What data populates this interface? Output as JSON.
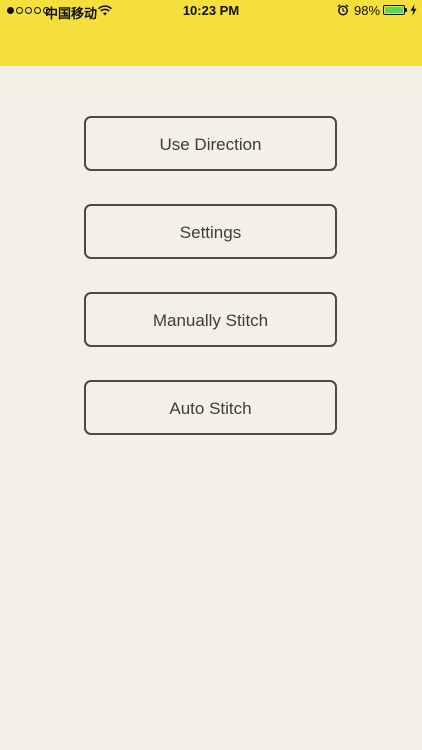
{
  "status_bar": {
    "signal_dots": [
      true,
      false,
      false,
      false,
      false
    ],
    "carrier": "中国移动",
    "time": "10:23 PM",
    "battery_percent_text": "98%",
    "battery_level": 0.98,
    "icons": [
      "wifi-icon",
      "alarm-icon",
      "battery-icon",
      "charging-bolt-icon"
    ]
  },
  "header": {
    "color": "#f5df3d"
  },
  "menu": {
    "buttons": [
      {
        "label": "Use Direction"
      },
      {
        "label": "Settings"
      },
      {
        "label": "Manually Stitch"
      },
      {
        "label": "Auto Stitch"
      }
    ]
  },
  "colors": {
    "background": "#f3f1e5",
    "header": "#f5df3d",
    "button_border": "#4a4a4a",
    "button_text": "#3d3d3d",
    "battery_fill": "#4cd964"
  }
}
